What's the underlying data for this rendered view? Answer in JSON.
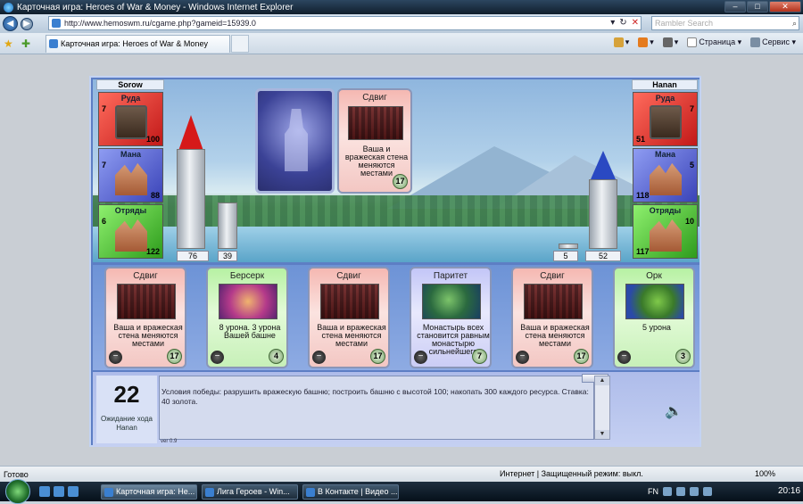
{
  "window": {
    "title": "Карточная игра: Heroes of War & Money - Windows Internet Explorer",
    "address": "http://www.hemoswm.ru/cgame.php?gameid=15939.0",
    "search_placeholder": "Rambler Search",
    "tab_label": "Карточная игра: Heroes of War & Money",
    "cmd_page": "Страница",
    "cmd_service": "Сервис"
  },
  "game": {
    "player_left": {
      "name": "Sorow",
      "ore": {
        "label": "Руда",
        "income": "7",
        "amount": "100"
      },
      "mana": {
        "label": "Мана",
        "income": "7",
        "amount": "88"
      },
      "troops": {
        "label": "Отряды",
        "income": "6",
        "amount": "122"
      },
      "tower": "76",
      "wall": "39",
      "tower_roof_color": "#d61919"
    },
    "player_right": {
      "name": "Hanan",
      "ore": {
        "label": "Руда",
        "income": "7",
        "amount": "51"
      },
      "mana": {
        "label": "Мана",
        "income": "5",
        "amount": "118"
      },
      "troops": {
        "label": "Отряды",
        "income": "10",
        "amount": "117"
      },
      "tower": "52",
      "wall": "5",
      "tower_roof_color": "#2a49c2"
    },
    "played_card": {
      "title": "Сдвиг",
      "desc": "Ваша и вражеская стена меняются местами",
      "cost": "17"
    },
    "hand": [
      {
        "title": "Сдвиг",
        "desc": "Ваша и вражеская стена меняются местами",
        "cost": "17",
        "color": "red",
        "pic": "wall-swap-picture"
      },
      {
        "title": "Берсерк",
        "desc": "8 урона. 3 урона Вашей башне",
        "cost": "4",
        "color": "green",
        "pic": "berserk-picture"
      },
      {
        "title": "Сдвиг",
        "desc": "Ваша и вражеская стена меняются местами",
        "cost": "17",
        "color": "red",
        "pic": "wall-swap-picture"
      },
      {
        "title": "Паритет",
        "desc": "Монастырь всех становится равным монастырю сильнейшего",
        "cost": "7",
        "color": "blue",
        "pic": "parity-picture"
      },
      {
        "title": "Сдвиг",
        "desc": "Ваша и вражеская стена меняются местами",
        "cost": "17",
        "color": "red",
        "pic": "wall-swap-picture"
      },
      {
        "title": "Орк",
        "desc": "5 урона",
        "cost": "3",
        "color": "green",
        "pic": "orc-picture"
      }
    ],
    "turn_number": "22",
    "waiting_label": "Ожидание хода Hanan",
    "message": "Условия победы: разрушить вражескую башню; построить башню с высотой 100; накопать 300 каждого ресурса. Ставка: 40 золота.",
    "version": "ver 0.9"
  },
  "statusbar": {
    "status": "Готово",
    "zone": "Интернет | Защищенный режим: выкл.",
    "zoom": "100%"
  },
  "taskbar": {
    "tasks": [
      "Карточная игра: He...",
      "Лига Героев - Win...",
      "В Контакте | Видео ..."
    ],
    "lang": "FN",
    "clock": "20:16"
  }
}
